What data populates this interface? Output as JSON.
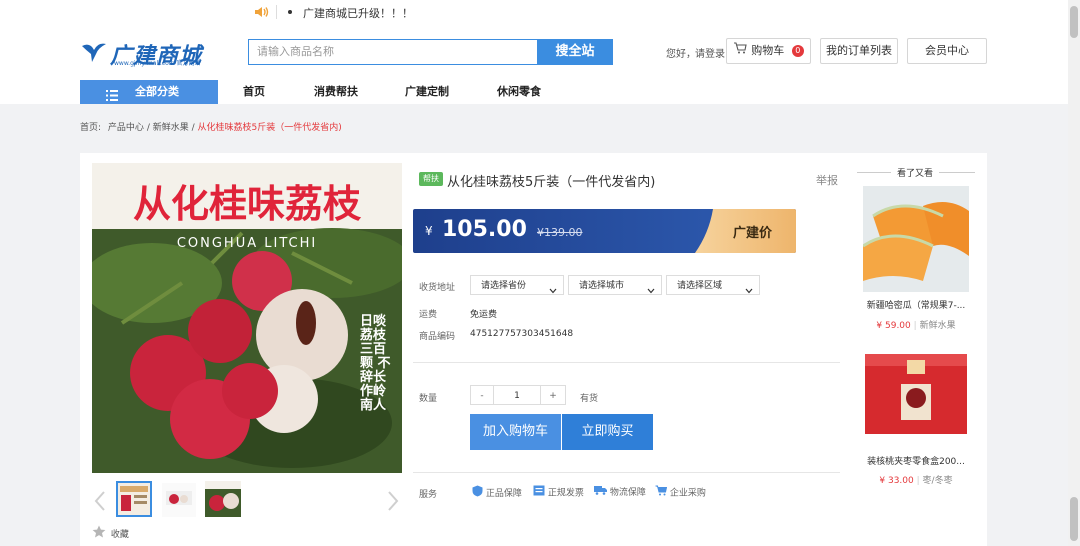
{
  "topbar": {
    "speaker_icon": "speaker-icon",
    "notice": "广建商城已升级！！！"
  },
  "header": {
    "logo_text": "广建商城",
    "logo_sub": "www.gjmy-mall.com 官方网站",
    "search_placeholder": "请输入商品名称",
    "search_button": "搜全站",
    "greeting": "您好，",
    "login": "请登录",
    "cart_label": "购物车",
    "cart_count": "0",
    "orders_label": "我的订单列表",
    "member_label": "会员中心"
  },
  "nav": {
    "all_label": "全部分类",
    "items": [
      "首页",
      "消费帮扶",
      "广建定制",
      "休闲零食"
    ]
  },
  "breadcrumb": {
    "home": "首页:",
    "center": "产品中心",
    "sep1": "/",
    "category": "新鲜水果",
    "sep2": "/",
    "current": "从化桂味荔枝5斤装（一件代发省内)"
  },
  "image": {
    "banner_title": "从化桂味荔枝",
    "banner_en": "CONGHUA LITCHI",
    "poem": "日啖荔枝三百颗 不辞长作岭南人"
  },
  "product": {
    "tag": "帮扶",
    "title": "从化桂味荔枝5斤装（一件代发省内)",
    "report": "举报",
    "currency": "¥",
    "price": "105.00",
    "old_price": "¥139.00",
    "price_label": "广建价",
    "address_label": "收货地址",
    "province": "请选择省份",
    "city": "请选择城市",
    "district": "请选择区域",
    "freight_label": "运费",
    "freight": "免运费",
    "code_label": "商品编码",
    "code": "475127757303451648",
    "qty_label": "数量",
    "qty_minus": "-",
    "qty_value": "1",
    "qty_plus": "+",
    "stock": "有货",
    "add_cart": "加入购物车",
    "buy_now": "立即购买",
    "service_label": "服务",
    "services": [
      "正品保障",
      "正规发票",
      "物流保障",
      "企业采购"
    ],
    "favorite": "收藏"
  },
  "sidebar": {
    "title": "看了又看",
    "items": [
      {
        "name": "新疆哈密瓜（常规果7-...",
        "price": "¥ 59.00",
        "category": "新鲜水果"
      },
      {
        "name": "装核桃夹枣零食盒200...",
        "price": "¥ 33.00",
        "category": "枣/冬枣"
      }
    ]
  },
  "colors": {
    "accent": "#3b8de0",
    "price_red": "#e4393c",
    "tag_green": "#5cb85c",
    "price_bar": "#234a9a",
    "price_gold": "#f3c98b"
  }
}
